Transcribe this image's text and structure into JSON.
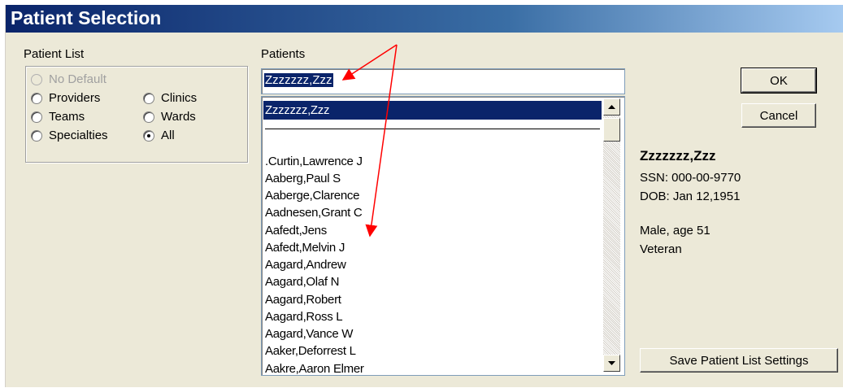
{
  "window": {
    "title": "Patient Selection"
  },
  "patient_list": {
    "label": "Patient List",
    "options": [
      {
        "label": "No Default",
        "checked": false,
        "disabled": true
      },
      {
        "label": "Providers",
        "checked": false,
        "disabled": false
      },
      {
        "label": "Clinics",
        "checked": false,
        "disabled": false
      },
      {
        "label": "Teams",
        "checked": false,
        "disabled": false
      },
      {
        "label": "Wards",
        "checked": false,
        "disabled": false
      },
      {
        "label": "Specialties",
        "checked": false,
        "disabled": false
      },
      {
        "label": "All",
        "checked": true,
        "disabled": false
      }
    ]
  },
  "patients": {
    "label": "Patients",
    "search_value": "Zzzzzzz,Zzz",
    "selected": "Zzzzzzz,Zzz",
    "items": [
      ".Curtin,Lawrence J",
      "Aaberg,Paul S",
      "Aaberge,Clarence",
      "Aadnesen,Grant C",
      "Aafedt,Jens",
      "Aafedt,Melvin J",
      "Aagard,Andrew",
      "Aagard,Olaf N",
      "Aagard,Robert",
      "Aagard,Ross L",
      "Aagard,Vance W",
      "Aaker,Deforrest L",
      "Aakre,Aaron Elmer"
    ]
  },
  "buttons": {
    "ok": "OK",
    "cancel": "Cancel",
    "save_settings": "Save Patient List Settings"
  },
  "patient_info": {
    "name": "Zzzzzzz,Zzz",
    "ssn": "SSN:  000-00-9770",
    "dob": "DOB:  Jan 12,1951",
    "sex_age": "Male, age 51",
    "status": "Veteran"
  },
  "annotation": {
    "arrow_color": "#ff0000"
  }
}
